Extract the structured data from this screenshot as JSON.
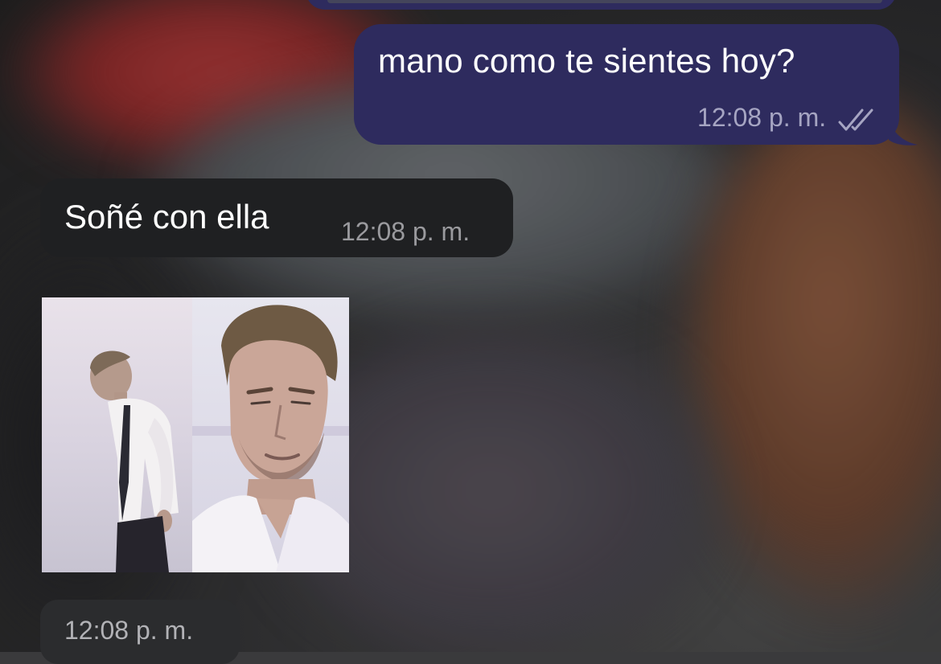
{
  "messages": [
    {
      "direction": "outgoing",
      "text": "mano como te sientes hoy?",
      "time": "12:08 p. m.",
      "status_icon": "double-check-read-icon"
    },
    {
      "direction": "incoming",
      "text": "Soñé con ella",
      "time": "12:08 p. m."
    },
    {
      "direction": "incoming",
      "type": "image",
      "image_subject": "collage of a man in a white shirt",
      "time": "12:08 p. m."
    }
  ],
  "colors": {
    "outgoing_bubble": "#2e2b5e",
    "incoming_bubble": "#1f2022",
    "meta_text_outgoing": "#a6a5c2",
    "meta_text_incoming": "#9a9a9e"
  }
}
